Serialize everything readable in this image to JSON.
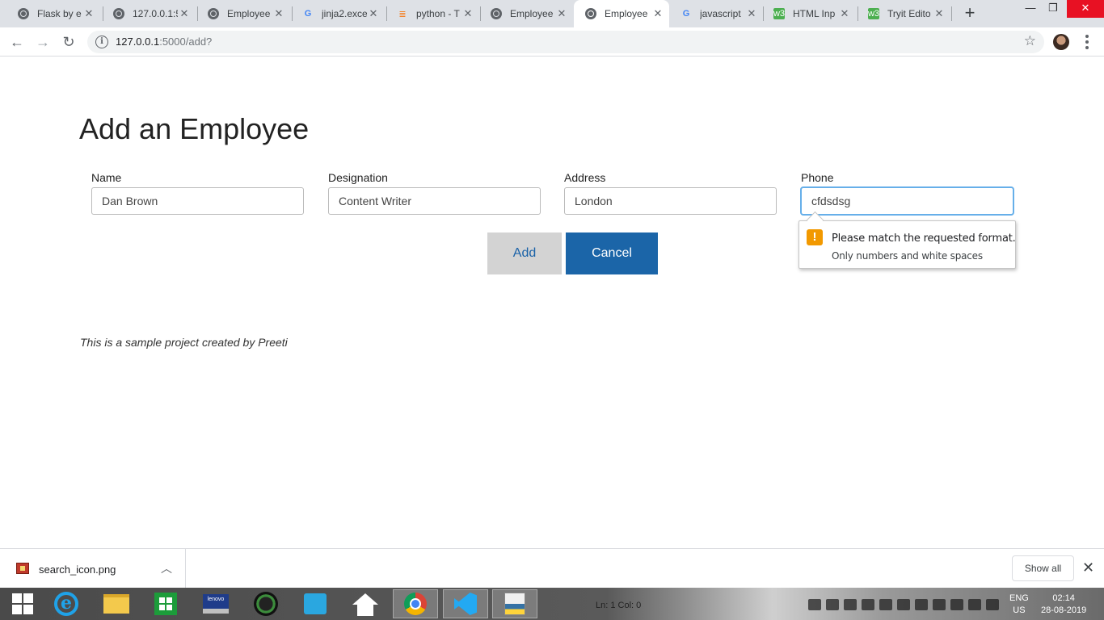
{
  "browser": {
    "tabs": [
      {
        "title": "Flask by e",
        "favicon": "globe-icon"
      },
      {
        "title": "127.0.0.1:5",
        "favicon": "globe-icon"
      },
      {
        "title": "Employee",
        "favicon": "globe-icon"
      },
      {
        "title": "jinja2.exce",
        "favicon": "google-icon"
      },
      {
        "title": "python - T",
        "favicon": "stackoverflow-icon"
      },
      {
        "title": "Employee",
        "favicon": "globe-icon"
      },
      {
        "title": "Employee",
        "favicon": "globe-icon"
      },
      {
        "title": "javascript",
        "favicon": "google-icon"
      },
      {
        "title": "HTML Inp",
        "favicon": "w3schools-icon"
      },
      {
        "title": "Tryit Edito",
        "favicon": "w3schools-icon"
      }
    ],
    "active_tab": 6,
    "url_host": "127.0.0.1",
    "url_path": ":5000/add?"
  },
  "page": {
    "title": "Add an Employee",
    "fields": [
      {
        "label": "Name",
        "value": "Dan Brown"
      },
      {
        "label": "Designation",
        "value": "Content Writer"
      },
      {
        "label": "Address",
        "value": "London"
      },
      {
        "label": "Phone",
        "value": "cfdsdsg"
      }
    ],
    "add_label": "Add",
    "cancel_label": "Cancel",
    "validation": {
      "message": "Please match the requested format.",
      "hint": "Only numbers and white spaces",
      "icon": "warning-icon"
    },
    "footer_note": "This is a sample project created by Preeti"
  },
  "download_bar": {
    "file_name": "search_icon.png",
    "show_all_label": "Show all"
  },
  "taskbar": {
    "status_text": "Ln: 1   Col: 0",
    "lang_line1": "ENG",
    "lang_line2": "US",
    "time": "02:14",
    "date": "28-08-2019"
  },
  "colors": {
    "cancel_button": "#1b65a8",
    "add_button": "#d3d3d3",
    "focus_ring": "#66afe9",
    "warning": "#f29900"
  }
}
